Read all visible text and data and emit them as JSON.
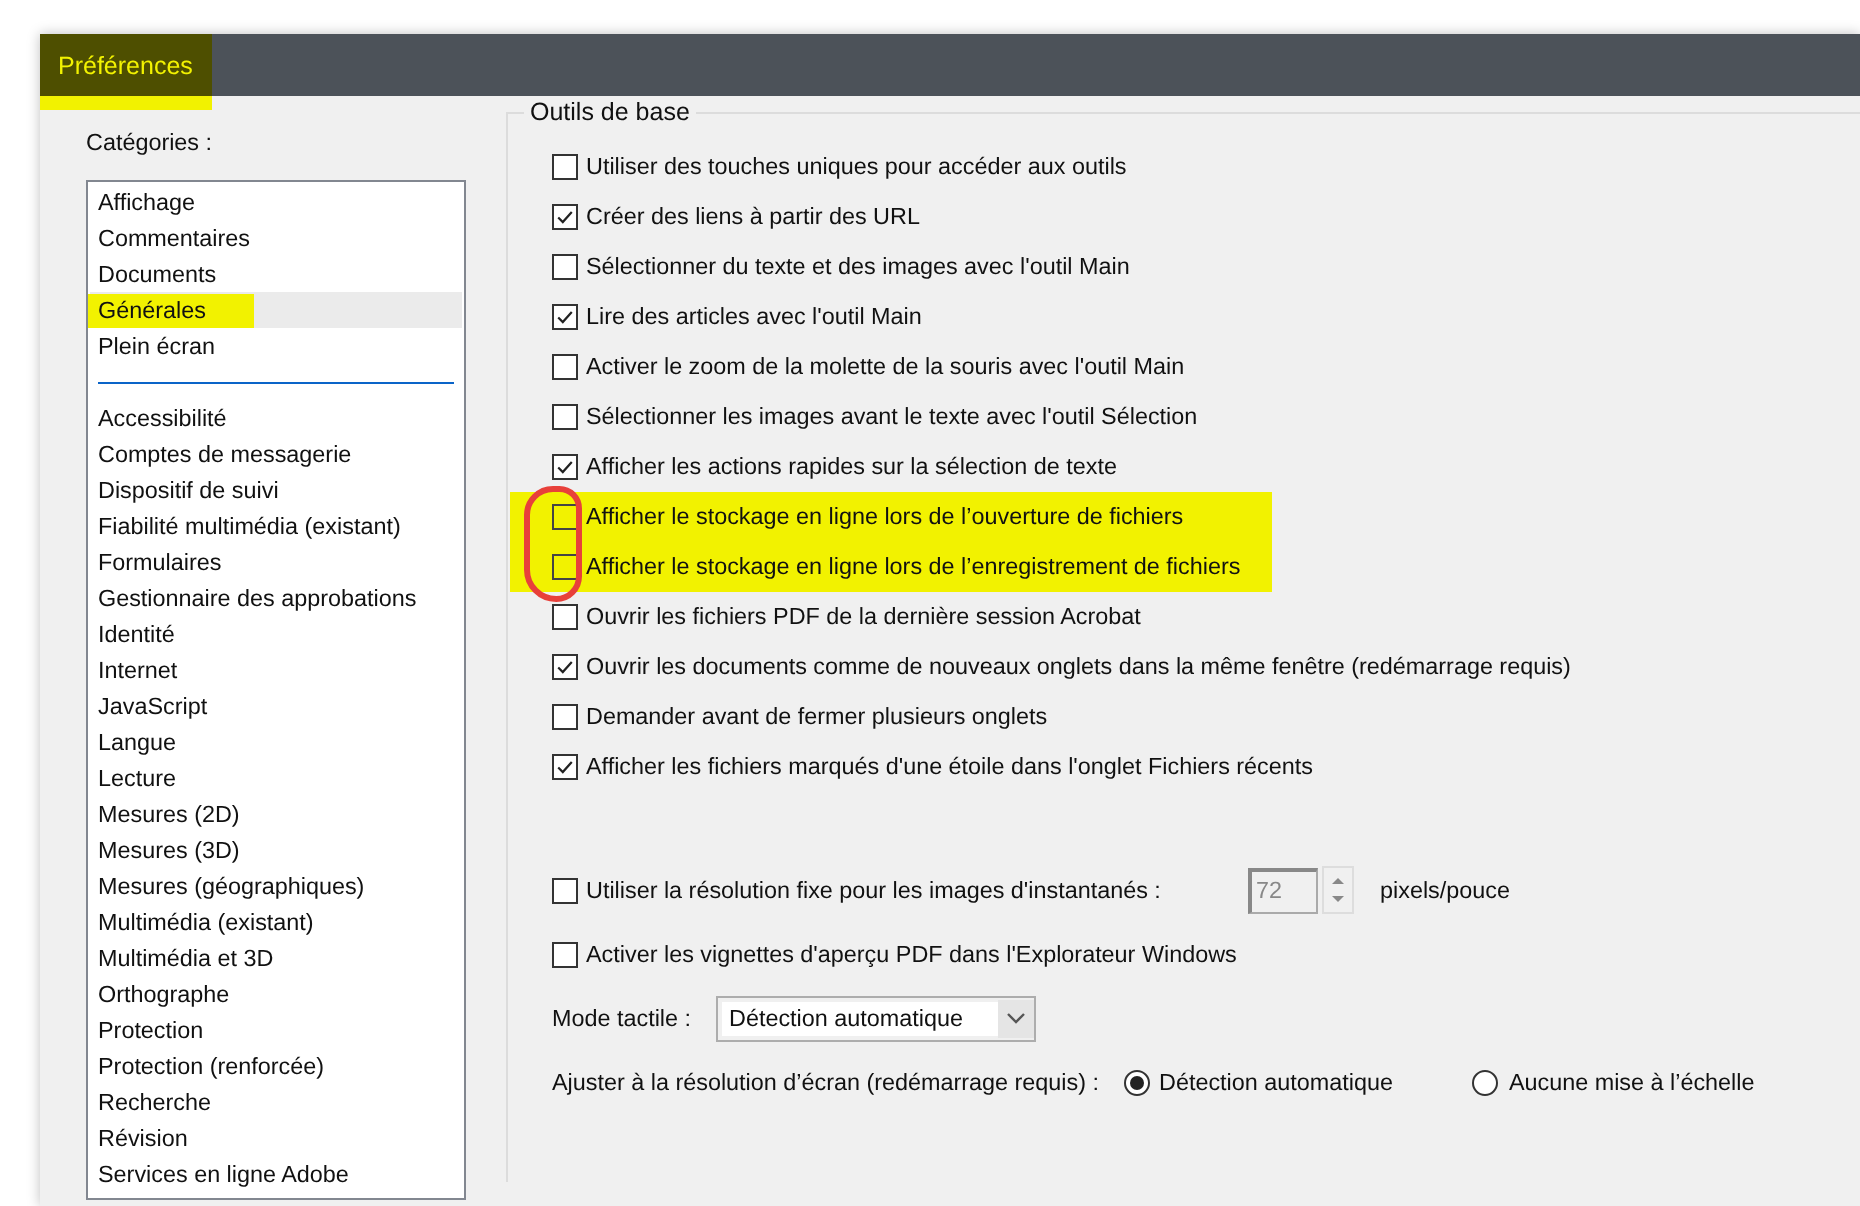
{
  "window": {
    "title": "Préférences",
    "highlighted": true
  },
  "categories": {
    "label": "Catégories :",
    "groups": [
      [
        {
          "label": "Affichage",
          "selected": false,
          "highlighted": false
        },
        {
          "label": "Commentaires",
          "selected": false,
          "highlighted": false
        },
        {
          "label": "Documents",
          "selected": false,
          "highlighted": false
        },
        {
          "label": "Générales",
          "selected": true,
          "highlighted": true
        },
        {
          "label": "Plein écran",
          "selected": false,
          "highlighted": false
        }
      ],
      [
        {
          "label": "Accessibilité",
          "selected": false,
          "highlighted": false
        },
        {
          "label": "Comptes de messagerie",
          "selected": false,
          "highlighted": false
        },
        {
          "label": "Dispositif de suivi",
          "selected": false,
          "highlighted": false
        },
        {
          "label": "Fiabilité multimédia (existant)",
          "selected": false,
          "highlighted": false
        },
        {
          "label": "Formulaires",
          "selected": false,
          "highlighted": false
        },
        {
          "label": "Gestionnaire des approbations",
          "selected": false,
          "highlighted": false
        },
        {
          "label": "Identité",
          "selected": false,
          "highlighted": false
        },
        {
          "label": "Internet",
          "selected": false,
          "highlighted": false
        },
        {
          "label": "JavaScript",
          "selected": false,
          "highlighted": false
        },
        {
          "label": "Langue",
          "selected": false,
          "highlighted": false
        },
        {
          "label": "Lecture",
          "selected": false,
          "highlighted": false
        },
        {
          "label": "Mesures (2D)",
          "selected": false,
          "highlighted": false
        },
        {
          "label": "Mesures (3D)",
          "selected": false,
          "highlighted": false
        },
        {
          "label": "Mesures (géographiques)",
          "selected": false,
          "highlighted": false
        },
        {
          "label": "Multimédia (existant)",
          "selected": false,
          "highlighted": false
        },
        {
          "label": "Multimédia et 3D",
          "selected": false,
          "highlighted": false
        },
        {
          "label": "Orthographe",
          "selected": false,
          "highlighted": false
        },
        {
          "label": "Protection",
          "selected": false,
          "highlighted": false
        },
        {
          "label": "Protection (renforcée)",
          "selected": false,
          "highlighted": false
        },
        {
          "label": "Recherche",
          "selected": false,
          "highlighted": false
        },
        {
          "label": "Révision",
          "selected": false,
          "highlighted": false
        },
        {
          "label": "Services en ligne Adobe",
          "selected": false,
          "highlighted": false
        }
      ]
    ]
  },
  "basic_tools": {
    "title": "Outils de base",
    "options": [
      {
        "label": "Utiliser des touches uniques pour accéder aux outils",
        "checked": false,
        "highlighted": false,
        "circled": false
      },
      {
        "label": "Créer des liens à partir des URL",
        "checked": true,
        "highlighted": false,
        "circled": false
      },
      {
        "label": "Sélectionner du texte et des images avec l'outil Main",
        "checked": false,
        "highlighted": false,
        "circled": false
      },
      {
        "label": "Lire des articles avec l'outil Main",
        "checked": true,
        "highlighted": false,
        "circled": false
      },
      {
        "label": "Activer le zoom de la molette de la souris avec l'outil Main",
        "checked": false,
        "highlighted": false,
        "circled": false
      },
      {
        "label": "Sélectionner les images avant le texte avec l'outil Sélection",
        "checked": false,
        "highlighted": false,
        "circled": false
      },
      {
        "label": "Afficher les actions rapides sur la sélection de texte",
        "checked": true,
        "highlighted": false,
        "circled": false
      },
      {
        "label": "Afficher le stockage en ligne lors de l’ouverture de fichiers",
        "checked": false,
        "highlighted": true,
        "circled": true
      },
      {
        "label": "Afficher le stockage en ligne lors de l’enregistrement de fichiers",
        "checked": false,
        "highlighted": true,
        "circled": true
      },
      {
        "label": "Ouvrir les fichiers PDF de la dernière session Acrobat",
        "checked": false,
        "highlighted": false,
        "circled": false
      },
      {
        "label": "Ouvrir les documents comme de nouveaux onglets dans la même fenêtre (redémarrage requis)",
        "checked": true,
        "highlighted": false,
        "circled": false
      },
      {
        "label": "Demander avant de fermer plusieurs onglets",
        "checked": false,
        "highlighted": false,
        "circled": false
      },
      {
        "label": "Afficher les fichiers marqués d'une étoile dans l'onglet Fichiers récents",
        "checked": true,
        "highlighted": false,
        "circled": false
      }
    ],
    "snapshot": {
      "label": "Utiliser la résolution fixe pour les images d'instantanés :",
      "checked": false,
      "value": "72",
      "unit": "pixels/pouce"
    },
    "thumbnails": {
      "label": "Activer les vignettes d'aperçu PDF dans l'Explorateur Windows",
      "checked": false
    },
    "touch_mode": {
      "label": "Mode tactile :",
      "value": "Détection automatique"
    },
    "screen_fit": {
      "label": "Ajuster à la résolution d’écran (redémarrage requis) :",
      "choices": [
        {
          "label": "Détection automatique",
          "selected": true
        },
        {
          "label": "Aucune mise à l’échelle",
          "selected": false
        }
      ]
    }
  }
}
